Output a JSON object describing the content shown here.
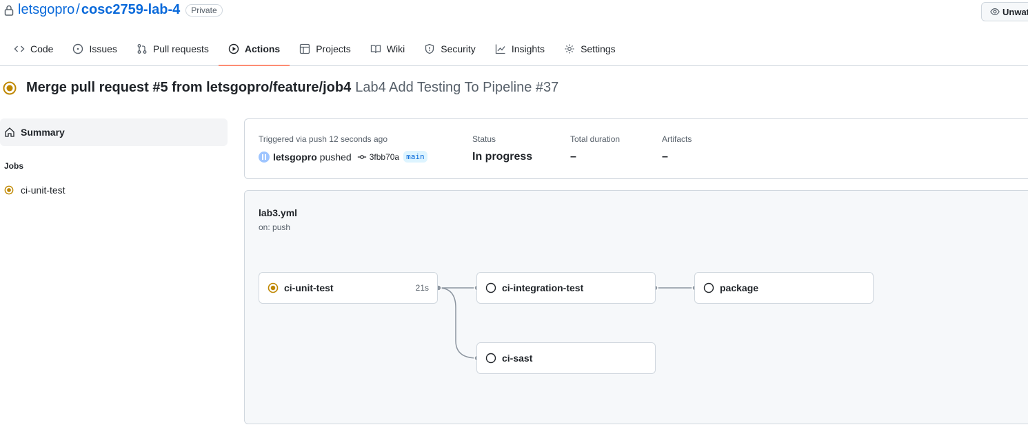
{
  "repo": {
    "owner": "letsgopro",
    "separator": "/",
    "name": "cosc2759-lab-4",
    "visibility": "Private",
    "watch_label": "Unwat"
  },
  "tabs": [
    {
      "label": "Code",
      "icon": "code-icon"
    },
    {
      "label": "Issues",
      "icon": "issue-icon"
    },
    {
      "label": "Pull requests",
      "icon": "pull-request-icon"
    },
    {
      "label": "Actions",
      "icon": "play-icon",
      "active": true
    },
    {
      "label": "Projects",
      "icon": "table-icon"
    },
    {
      "label": "Wiki",
      "icon": "book-icon"
    },
    {
      "label": "Security",
      "icon": "shield-icon"
    },
    {
      "label": "Insights",
      "icon": "graph-icon"
    },
    {
      "label": "Settings",
      "icon": "gear-icon"
    }
  ],
  "run": {
    "title_strong": "Merge pull request #5 from letsgopro/feature/job4",
    "title_rest": "Lab4 Add Testing To Pipeline #37"
  },
  "sidebar": {
    "summary_label": "Summary",
    "jobs_label": "Jobs",
    "jobs": [
      {
        "label": "ci-unit-test",
        "status": "in_progress"
      }
    ]
  },
  "summary": {
    "trigger_label": "Triggered via push 12 seconds ago",
    "pusher": "letsgopro",
    "pushed_text": "pushed",
    "commit": "3fbb70a",
    "branch": "main",
    "status_label": "Status",
    "status_value": "In progress",
    "duration_label": "Total duration",
    "duration_value": "–",
    "artifacts_label": "Artifacts",
    "artifacts_value": "–"
  },
  "workflow": {
    "file": "lab3.yml",
    "trigger": "on: push",
    "jobs": [
      {
        "label": "ci-unit-test",
        "status": "in_progress",
        "duration": "21s"
      },
      {
        "label": "ci-integration-test",
        "status": "queued"
      },
      {
        "label": "package",
        "status": "queued"
      },
      {
        "label": "ci-sast",
        "status": "queued"
      }
    ]
  },
  "colors": {
    "link": "#0969da",
    "in_progress": "#bf8700",
    "tab_underline": "#fd8c73",
    "border": "#d0d7de"
  }
}
